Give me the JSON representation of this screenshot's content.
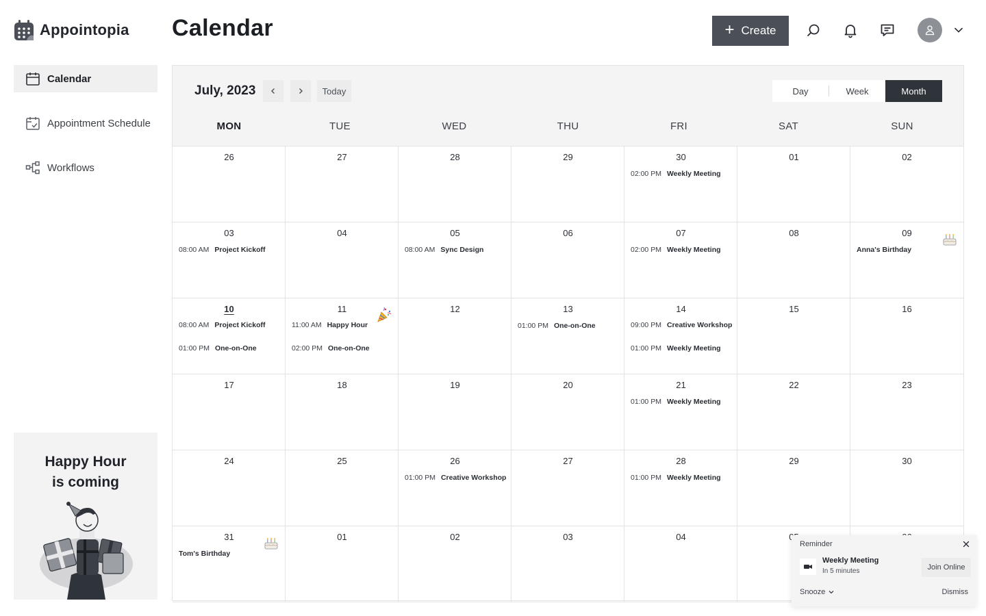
{
  "app": {
    "name": "Appointopia"
  },
  "header": {
    "title": "Calendar",
    "create_label": "Create",
    "icons": [
      "search-icon",
      "bell-icon",
      "chat-icon",
      "avatar-icon",
      "chevron-down-icon"
    ]
  },
  "sidebar": {
    "items": [
      {
        "label": "Calendar",
        "icon": "calendar-icon",
        "active": true
      },
      {
        "label": "Appointment Schedule",
        "icon": "calendar-check-icon",
        "active": false
      },
      {
        "label": "Workflows",
        "icon": "workflow-icon",
        "active": false
      }
    ],
    "promo": {
      "line1": "Happy Hour",
      "line2": "is coming"
    }
  },
  "calendar": {
    "month_label": "July, 2023",
    "today_label": "Today",
    "views": [
      "Day",
      "Week",
      "Month"
    ],
    "active_view": "Month",
    "weekdays": [
      "MON",
      "TUE",
      "WED",
      "THU",
      "FRI",
      "SAT",
      "SUN"
    ],
    "weeks": [
      [
        {
          "day": "26",
          "events": []
        },
        {
          "day": "27",
          "events": []
        },
        {
          "day": "28",
          "events": []
        },
        {
          "day": "29",
          "events": []
        },
        {
          "day": "30",
          "events": [
            {
              "time": "02:00 PM",
              "title": "Weekly Meeting"
            }
          ]
        },
        {
          "day": "01",
          "events": []
        },
        {
          "day": "02",
          "events": []
        }
      ],
      [
        {
          "day": "03",
          "events": [
            {
              "time": "08:00 AM",
              "title": "Project Kickoff"
            }
          ]
        },
        {
          "day": "04",
          "events": []
        },
        {
          "day": "05",
          "events": [
            {
              "time": "08:00 AM",
              "title": "Sync Design"
            }
          ]
        },
        {
          "day": "06",
          "events": []
        },
        {
          "day": "07",
          "events": [
            {
              "time": "02:00 PM",
              "title": "Weekly Meeting"
            }
          ]
        },
        {
          "day": "08",
          "events": []
        },
        {
          "day": "09",
          "events": [
            {
              "time": "",
              "title": "Anna's Birthday"
            }
          ],
          "emoji": "cake-icon"
        }
      ],
      [
        {
          "day": "10",
          "today": true,
          "events": [
            {
              "time": "08:00 AM",
              "title": "Project Kickoff"
            },
            {
              "time": "01:00 PM",
              "title": "One-on-One"
            }
          ]
        },
        {
          "day": "11",
          "events": [
            {
              "time": "11:00 AM",
              "title": "Happy Hour"
            },
            {
              "time": "02:00 PM",
              "title": "One-on-One"
            }
          ],
          "emoji": "party-popper-icon"
        },
        {
          "day": "12",
          "events": []
        },
        {
          "day": "13",
          "events": [
            {
              "time": "01:00 PM",
              "title": "One-on-One"
            }
          ]
        },
        {
          "day": "14",
          "events": [
            {
              "time": "09:00 PM",
              "title": "Creative Workshop"
            },
            {
              "time": "01:00 PM",
              "title": "Weekly Meeting"
            }
          ]
        },
        {
          "day": "15",
          "events": []
        },
        {
          "day": "16",
          "events": []
        }
      ],
      [
        {
          "day": "17",
          "events": []
        },
        {
          "day": "18",
          "events": []
        },
        {
          "day": "19",
          "events": []
        },
        {
          "day": "20",
          "events": []
        },
        {
          "day": "21",
          "events": [
            {
              "time": "01:00 PM",
              "title": "Weekly Meeting"
            }
          ]
        },
        {
          "day": "22",
          "events": []
        },
        {
          "day": "23",
          "events": []
        }
      ],
      [
        {
          "day": "24",
          "events": []
        },
        {
          "day": "25",
          "events": []
        },
        {
          "day": "26",
          "events": [
            {
              "time": "01:00 PM",
              "title": "Creative Workshop"
            }
          ]
        },
        {
          "day": "27",
          "events": []
        },
        {
          "day": "28",
          "events": [
            {
              "time": "01:00 PM",
              "title": "Weekly Meeting"
            }
          ]
        },
        {
          "day": "29",
          "events": []
        },
        {
          "day": "30",
          "events": []
        }
      ],
      [
        {
          "day": "31",
          "events": [
            {
              "time": "",
              "title": "Tom's Birthday"
            }
          ],
          "emoji": "cake-icon"
        },
        {
          "day": "01",
          "events": []
        },
        {
          "day": "02",
          "events": []
        },
        {
          "day": "03",
          "events": []
        },
        {
          "day": "04",
          "events": []
        },
        {
          "day": "05",
          "events": []
        },
        {
          "day": "06",
          "events": []
        }
      ]
    ]
  },
  "reminder": {
    "label": "Reminder",
    "title": "Weekly Meeting",
    "subtitle": "In 5 minutes",
    "join_label": "Join Online",
    "snooze_label": "Snooze",
    "dismiss_label": "Dismiss"
  }
}
